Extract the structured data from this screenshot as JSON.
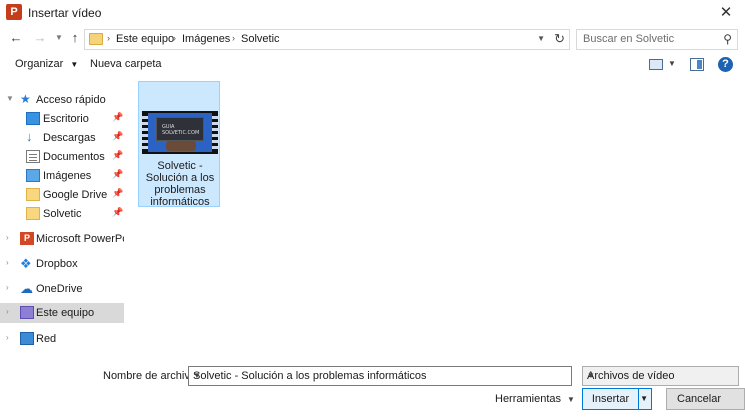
{
  "window": {
    "title": "Insertar vídeo",
    "app_icon_letter": "P"
  },
  "address": {
    "breadcrumbs": [
      "Este equipo",
      "Imágenes",
      "Solvetic"
    ]
  },
  "search": {
    "placeholder": "Buscar en Solvetic"
  },
  "toolbar": {
    "organize_label": "Organizar",
    "new_folder_label": "Nueva carpeta"
  },
  "sidebar": {
    "quick_access": "Acceso rápido",
    "pinned": [
      {
        "label": "Escritorio",
        "icon": "desktop-icon"
      },
      {
        "label": "Descargas",
        "icon": "download-icon"
      },
      {
        "label": "Documentos",
        "icon": "documents-icon"
      },
      {
        "label": "Imágenes",
        "icon": "pictures-icon"
      },
      {
        "label": "Google Drive",
        "icon": "folder-icon"
      },
      {
        "label": "Solvetic",
        "icon": "folder-icon"
      }
    ],
    "powerpoint": "Microsoft PowerPoin",
    "dropbox": "Dropbox",
    "onedrive": "OneDrive",
    "this_pc": "Este equipo",
    "network": "Red"
  },
  "files": [
    {
      "name_lines": [
        "Solvetic -",
        "Solución a los",
        "problemas",
        "informáticos"
      ],
      "thumb_text": [
        "GUIA",
        "SOLVETIC.COM"
      ]
    }
  ],
  "bottom": {
    "filename_label": "Nombre de archivo:",
    "filename_value": "Solvetic - Solución a los problemas informáticos",
    "filetype_value": "Archivos de vídeo",
    "tools_label": "Herramientas",
    "insert_label": "Insertar",
    "cancel_label": "Cancelar"
  },
  "colors": {
    "accent": "#0078d7",
    "selection": "#cce8ff",
    "sidebar_selected": "#d9d9d9"
  }
}
